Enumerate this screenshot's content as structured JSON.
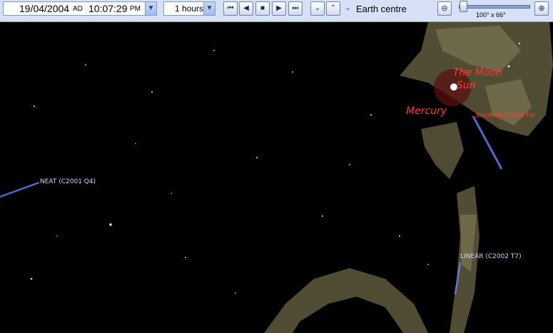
{
  "toolbar": {
    "date": "19/04/2004",
    "era": "AD",
    "time": "10:07:29",
    "ampm": "PM",
    "step": "1 hours",
    "centre": "Earth centre",
    "fov": "100° x 66°",
    "zoom_value": 0.05
  },
  "sky": {
    "objects": [
      {
        "name": "The Moon"
      },
      {
        "name": "Sun"
      },
      {
        "name": "Mercury"
      },
      {
        "name": "Bradfield (C2004 F4)"
      },
      {
        "name": "NEAT (C2001 Q4)"
      },
      {
        "name": "LINEAR (C2002 T7)"
      }
    ]
  },
  "colors": {
    "toolbar_bg": "#d6e1f7",
    "planet_label": "#ff3d2e",
    "comet_label": "#c9d3ff",
    "milky_way": "#6d6a48"
  }
}
